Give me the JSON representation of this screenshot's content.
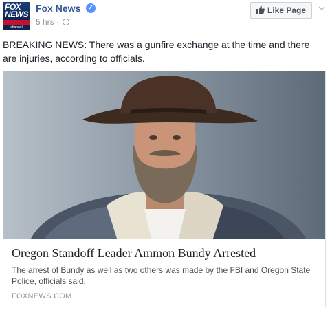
{
  "header": {
    "page_name": "Fox News",
    "timestamp": "5 hrs",
    "separator": "·",
    "like_label": "Like Page"
  },
  "post": {
    "text": "BREAKING NEWS: There was a gunfire exchange at the time and there are injuries, according to officials."
  },
  "card": {
    "title": "Oregon Standoff Leader Ammon Bundy Arrested",
    "description": "The arrest of Bundy as well as two others was made by the FBI and Oregon State Police, officials said.",
    "domain": "FOXNEWS.COM"
  },
  "colors": {
    "link_blue": "#365899",
    "verified": "#5890ff",
    "fox_red": "#c8102e",
    "fox_navy": "#0b2450"
  },
  "icons": [
    "fox-news-logo",
    "verified-icon",
    "globe-icon",
    "thumbs-up-icon",
    "chevron-down-icon"
  ]
}
